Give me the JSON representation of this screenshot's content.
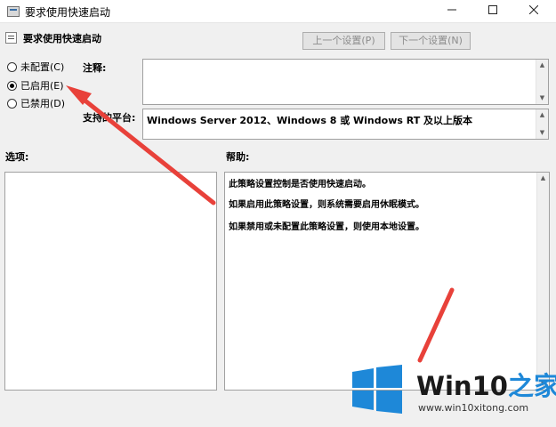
{
  "window": {
    "title": "要求使用快速启动",
    "minimize_icon": "minimize-icon",
    "maximize_icon": "maximize-icon",
    "close_icon": "close-icon"
  },
  "policy": {
    "title": "要求使用快速启动",
    "prev_label": "上一个设置(P)",
    "next_label": "下一个设置(N)"
  },
  "state_options": [
    {
      "label": "未配置(C)",
      "checked": false
    },
    {
      "label": "已启用(E)",
      "checked": true
    },
    {
      "label": "已禁用(D)",
      "checked": false
    }
  ],
  "comment": {
    "label": "注释:",
    "value": ""
  },
  "supported": {
    "label": "支持的平台:",
    "value": "Windows Server 2012、Windows 8 或 Windows RT 及以上版本"
  },
  "options": {
    "label": "选项:"
  },
  "help": {
    "label": "帮助:",
    "lines": [
      "此策略设置控制是否使用快速启动。",
      "如果启用此策略设置，则系统需要启用休眠模式。",
      "如果禁用或未配置此策略设置，则使用本地设置。"
    ]
  },
  "watermark": {
    "brand_en": "Win10",
    "brand_cn": "之家",
    "url": "www.win10xitong.com"
  },
  "colors": {
    "arrow": "#e8413a",
    "logo_blue": "#1e88d8"
  }
}
